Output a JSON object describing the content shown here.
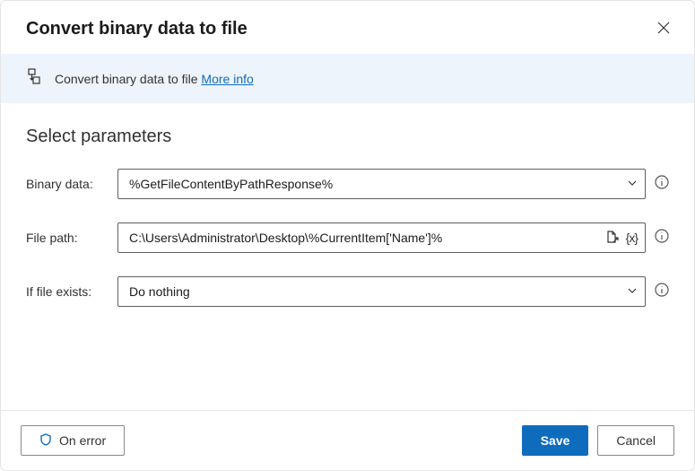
{
  "title": "Convert binary data to file",
  "banner": {
    "text": "Convert binary data to file ",
    "link_label": "More info"
  },
  "section_heading": "Select parameters",
  "fields": {
    "binary": {
      "label": "Binary data:",
      "value": "%GetFileContentByPathResponse%"
    },
    "filepath": {
      "label": "File path:",
      "value": "C:\\Users\\Administrator\\Desktop\\%CurrentItem['Name']%"
    },
    "ifexists": {
      "label": "If file exists:",
      "value": "Do nothing"
    }
  },
  "buttons": {
    "on_error": "On error",
    "save": "Save",
    "cancel": "Cancel"
  }
}
